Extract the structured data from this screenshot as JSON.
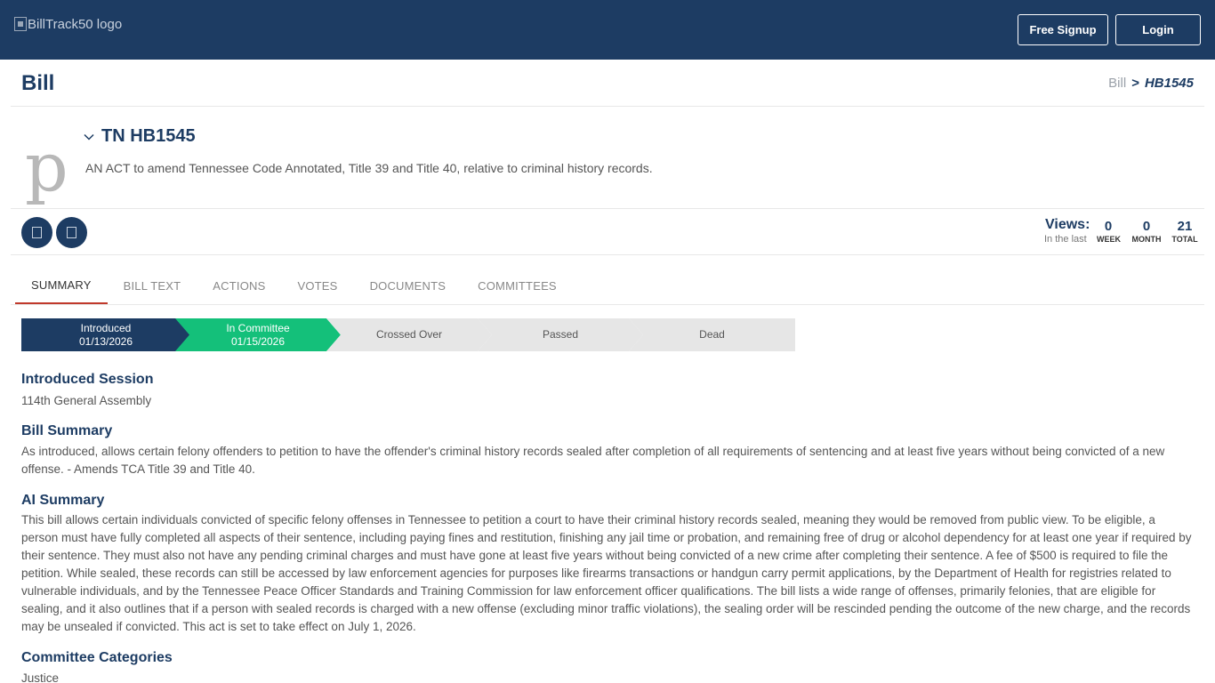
{
  "header": {
    "logo_alt": "BillTrack50 logo",
    "signup_label": "Free Signup",
    "login_label": "Login"
  },
  "page": {
    "title": "Bill",
    "breadcrumb": {
      "parent": "Bill",
      "separator": ">",
      "current": "HB1545"
    }
  },
  "bill": {
    "image_letter": "p",
    "id": "TN HB1545",
    "description": "AN ACT to amend Tennessee Code Annotated, Title 39 and Title 40, relative to criminal history records."
  },
  "views": {
    "label": "Views:",
    "sublabel": "In the last",
    "week": {
      "value": "0",
      "label": "WEEK"
    },
    "month": {
      "value": "0",
      "label": "MONTH"
    },
    "total": {
      "value": "21",
      "label": "TOTAL"
    }
  },
  "tabs": [
    {
      "label": "SUMMARY",
      "active": true
    },
    {
      "label": "BILL TEXT",
      "active": false
    },
    {
      "label": "ACTIONS",
      "active": false
    },
    {
      "label": "VOTES",
      "active": false
    },
    {
      "label": "DOCUMENTS",
      "active": false
    },
    {
      "label": "COMMITTEES",
      "active": false
    }
  ],
  "pipeline": [
    {
      "label": "Introduced",
      "date": "01/13/2026",
      "status": "done"
    },
    {
      "label": "In Committee",
      "date": "01/15/2026",
      "status": "current"
    },
    {
      "label": "Crossed Over",
      "date": "",
      "status": "pending"
    },
    {
      "label": "Passed",
      "date": "",
      "status": "pending"
    },
    {
      "label": "Dead",
      "date": "",
      "status": "pending"
    }
  ],
  "sections": {
    "session_title": "Introduced Session",
    "session_value": "114th General Assembly",
    "summary_title": "Bill Summary",
    "summary_text": "As introduced, allows certain felony offenders to petition to have the offender's criminal history records sealed after completion of all requirements of sentencing and at least five years without being convicted of a new offense. - Amends TCA Title 39 and Title 40.",
    "ai_title": "AI Summary",
    "ai_text": "This bill allows certain individuals convicted of specific felony offenses in Tennessee to petition a court to have their criminal history records sealed, meaning they would be removed from public view. To be eligible, a person must have fully completed all aspects of their sentence, including paying fines and restitution, finishing any jail time or probation, and remaining free of drug or alcohol dependency for at least one year if required by their sentence. They must also not have any pending criminal charges and must have gone at least five years without being convicted of a new crime after completing their sentence. A fee of $500 is required to file the petition. While sealed, these records can still be accessed by law enforcement agencies for purposes like firearms transactions or handgun carry permit applications, by the Department of Health for registries related to vulnerable individuals, and by the Tennessee Peace Officer Standards and Training Commission for law enforcement officer qualifications. The bill lists a wide range of offenses, primarily felonies, that are eligible for sealing, and it also outlines that if a person with sealed records is charged with a new offense (excluding minor traffic violations), the sealing order will be rescinded pending the outcome of the new charge, and the records may be unsealed if convicted. This act is set to take effect on July 1, 2026.",
    "categories_title": "Committee Categories",
    "categories_value": "Justice"
  },
  "colors": {
    "brand": "#1d3c63",
    "stage_current": "#14c07a",
    "stage_pending": "#e6e6e6",
    "tab_active_underline": "#c0392b"
  }
}
